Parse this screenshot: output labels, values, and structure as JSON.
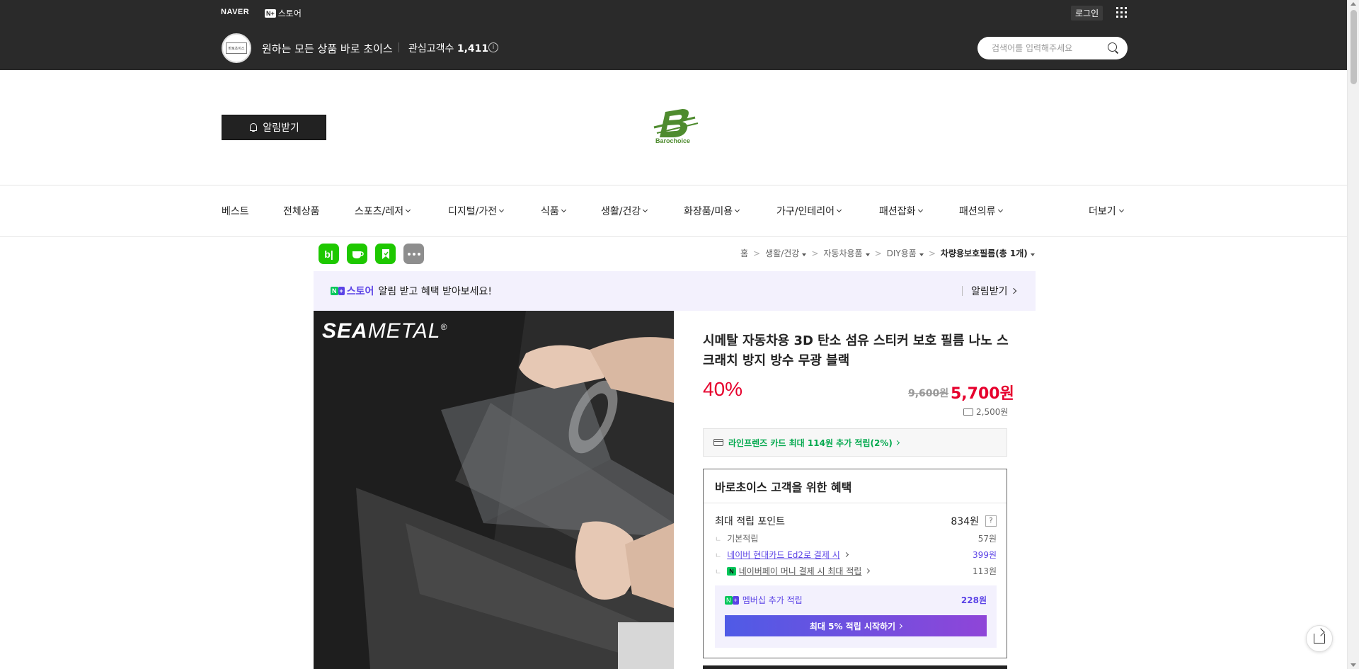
{
  "header": {
    "naver_logo": "NAVER",
    "nplus_badge": "N+",
    "nplus_label": "스토어",
    "login_label": "로그인",
    "store_avatar_text": "바로초이스",
    "store_name": "원하는 모든 상품 바로 초이스",
    "fans_label": "관심고객수",
    "fans_count": "1,411",
    "search_placeholder": "검색어를 입력해주세요"
  },
  "brand": {
    "notify_button": "알림받기",
    "logo_text": "Barochoice",
    "logo_color": "#4e8b2e"
  },
  "nav": {
    "items": [
      {
        "label": "베스트",
        "has_menu": false
      },
      {
        "label": "전체상품",
        "has_menu": false
      },
      {
        "label": "스포츠/레저",
        "has_menu": true
      },
      {
        "label": "디지털/가전",
        "has_menu": true
      },
      {
        "label": "식품",
        "has_menu": true
      },
      {
        "label": "생활/건강",
        "has_menu": true
      },
      {
        "label": "화장품/미용",
        "has_menu": true
      },
      {
        "label": "가구/인테리어",
        "has_menu": true
      },
      {
        "label": "패션잡화",
        "has_menu": true
      },
      {
        "label": "패션의류",
        "has_menu": true
      }
    ],
    "more_label": "더보기"
  },
  "share_icons": [
    "blog-icon",
    "cafe-icon",
    "bookmark-icon",
    "more-icon"
  ],
  "share_icon_text": {
    "blog": "b|"
  },
  "breadcrumb": {
    "home": "홈",
    "items": [
      "생활/건강",
      "자동차용품",
      "DIY용품"
    ],
    "current": "차량용보호필름(총 1개)"
  },
  "promo": {
    "n_badge": "N",
    "plus_badge": "+",
    "store_label": "스토어",
    "text": "알림 받고 혜택 받아보세요!",
    "action": "알림받기"
  },
  "product_image": {
    "brand_bold": "SEA",
    "brand_light": "METAL",
    "reg": "®"
  },
  "product": {
    "title": "시메탈 자동차용 3D 탄소 섬유 스티커 보호 필름 나노 스크래치 방지 방수 무광 블랙",
    "discount": "40%",
    "original_price": "9,600원",
    "sale_price": "5,700원",
    "shipping": "2,500원",
    "card_benefit": "라인프렌즈 카드 최대 114원 추가 적립(2%)"
  },
  "benefit": {
    "heading": "바로초이스 고객을 위한 혜택",
    "max_points_label": "최대 적립 포인트",
    "max_points_value": "834원",
    "help": "?",
    "rows": [
      {
        "label": "기본적립",
        "value": "57원"
      },
      {
        "label": "네이버 현대카드 Ed2로 결제 시",
        "value": "399원"
      },
      {
        "label": "네이버페이 머니 결제 시 최대 적립",
        "value": "113원"
      }
    ],
    "npay_badge": "N",
    "membership_label": "멤버십 추가 적립",
    "membership_value": "228원",
    "membership_button": "최대 5% 적립 시작하기"
  },
  "colors": {
    "header_bg": "#2a2a2a",
    "accent_red": "#e6002d",
    "accent_purple": "#5b43e6",
    "naver_green": "#03c75a"
  }
}
